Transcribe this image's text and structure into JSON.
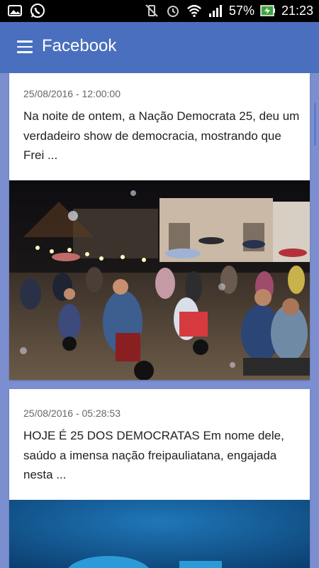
{
  "status_bar": {
    "battery": "57%",
    "time": "21:23",
    "icons": [
      "gallery-icon",
      "whatsapp-icon",
      "vibrate-off-icon",
      "alarm-icon",
      "wifi-icon",
      "signal-icon",
      "battery-charging-icon"
    ]
  },
  "app_bar": {
    "title": "Facebook",
    "menu_icon": "hamburger-menu-icon",
    "color": "#4a6fbe"
  },
  "feed": {
    "posts": [
      {
        "date": "25/08/2016 - 12:00:00",
        "text": "Na noite de ontem, a Nação Democrata 25, deu um verdadeiro show de democracia, mostrando que Frei ...",
        "image": "night-motorcycle-parade-photo"
      },
      {
        "date": "25/08/2016 - 05:28:53",
        "text": "HOJE É 25 DOS DEMOCRATAS Em nome dele, saúdo a imensa nação freipauliatana, engajada nesta ...",
        "image": "blue-campaign-banner-photo"
      }
    ]
  }
}
